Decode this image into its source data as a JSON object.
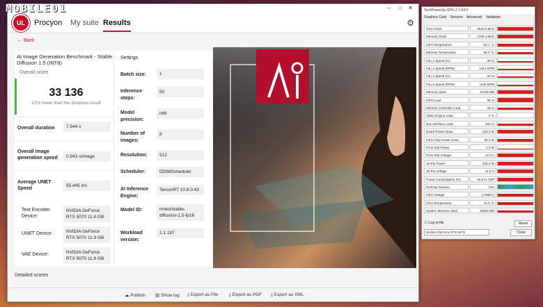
{
  "watermark": "MOBILE01",
  "app": {
    "brand": "Procyon",
    "tabs": [
      "My suite",
      "Results"
    ],
    "back": "Back"
  },
  "result": {
    "title": "AI Image Generation Benchmark - Stable Diffusion 1.5 (INT8)",
    "overall_label": "Overall score",
    "score": "33 136",
    "score_note": "12% lower than the previous result",
    "metrics": [
      {
        "label": "Overall duration",
        "value": "7.544 s"
      },
      {
        "label": "Overall image generation speed",
        "value": "0.943 s/image"
      },
      {
        "label": "Average UNET Speed",
        "value": "55.445 it/s"
      }
    ],
    "devices": [
      {
        "label": "Text Encoder Device:",
        "value": "NVIDIA GeForce RTX 5070 11.9 GB"
      },
      {
        "label": "UNET Device:",
        "value": "NVIDIA GeForce RTX 5070 11.9 GB"
      },
      {
        "label": "VAE Device:",
        "value": "NVIDIA GeForce RTX 5070 11.9 GB"
      }
    ]
  },
  "settings": {
    "title": "Settings",
    "items": [
      {
        "label": "Batch size:",
        "value": "1"
      },
      {
        "label": "Inference steps:",
        "value": "50"
      },
      {
        "label": "Model precision:",
        "value": "int8"
      },
      {
        "label": "Number of images:",
        "value": "8"
      },
      {
        "label": "Resolution:",
        "value": "512"
      },
      {
        "label": "Scheduler:",
        "value": "DDIMScheduler"
      },
      {
        "label": "AI Inference Engine:",
        "value": "TensorRT 10.8.0.43"
      },
      {
        "label": "Model ID:",
        "value": "nmkd/stable-diffusion-1.5-fp16"
      },
      {
        "label": "Workload version:",
        "value": "1.1.197"
      }
    ]
  },
  "detailed": "Detailed scores",
  "footer": [
    "Publish",
    "Show log",
    "Export as File",
    "Export as PDF",
    "Export as XML"
  ],
  "gpuz": {
    "title": "TechPowerUp GPU-Z 2.64.0",
    "tabs": [
      "Graphics Card",
      "Sensors",
      "Advanced",
      "Validation"
    ],
    "sensors": [
      {
        "n": "GPU Clock",
        "v": "2925.0 MHz",
        "f": 0.9
      },
      {
        "n": "Memory Clock",
        "v": "1750.1 MHz",
        "f": 0.85
      },
      {
        "n": "GPU Temperature",
        "v": "63.1 °C",
        "f": 0.6
      },
      {
        "n": "Memory Temperature",
        "v": "58.0 °C",
        "f": 0.5
      },
      {
        "n": "Fan 1 Speed (%)",
        "v": "30 %",
        "f": 0.35
      },
      {
        "n": "Fan 1 Speed (RPM)",
        "v": "1321 RPM",
        "f": 0.35
      },
      {
        "n": "Fan 2 Speed (%)",
        "v": "30 %",
        "f": 0.35
      },
      {
        "n": "Fan 2 Speed (RPM)",
        "v": "1146 RPM",
        "f": 0.3
      },
      {
        "n": "Memory Used",
        "v": "11225 MB",
        "f": 0.85
      },
      {
        "n": "GPU Load",
        "v": "96 %",
        "f": 0.9
      },
      {
        "n": "Memory Controller Load",
        "v": "46 %",
        "f": 0.5
      },
      {
        "n": "Video Engine Load",
        "v": "0 %",
        "f": 0
      },
      {
        "n": "Bus Interface Load",
        "v": "100 %",
        "f": 0.4
      },
      {
        "n": "Board Power Draw",
        "v": "232.2 W",
        "f": 0.85
      },
      {
        "n": "GPU Chip Power Draw",
        "v": "89.3 W",
        "f": 0.6
      },
      {
        "n": "PCIe Slot Power",
        "v": "1.9 W",
        "f": 0.1
      },
      {
        "n": "PCIe Slot Voltage",
        "v": "12.0 V",
        "f": 0.9
      },
      {
        "n": "16-Pin Power",
        "v": "230.4 W",
        "f": 0.85
      },
      {
        "n": "16-Pin Voltage",
        "v": "11.9 V",
        "f": 0.9
      },
      {
        "n": "Power Consumption (%)",
        "v": "92.9 % TDP",
        "f": 0.85
      },
      {
        "n": "PerfCap Reason",
        "v": "Pwr",
        "f": 1.0
      },
      {
        "n": "GPU Voltage",
        "v": "1.0560 V",
        "f": 0.8
      },
      {
        "n": "CPU Temperature",
        "v": "76.0 °C",
        "f": 0.7
      },
      {
        "n": "System Memory Used",
        "v": "16654 MB",
        "f": 0.6
      }
    ],
    "log": "Log to file",
    "reset": "Reset",
    "device": "NVIDIA GeForce RTX 5070",
    "close": "Close"
  }
}
